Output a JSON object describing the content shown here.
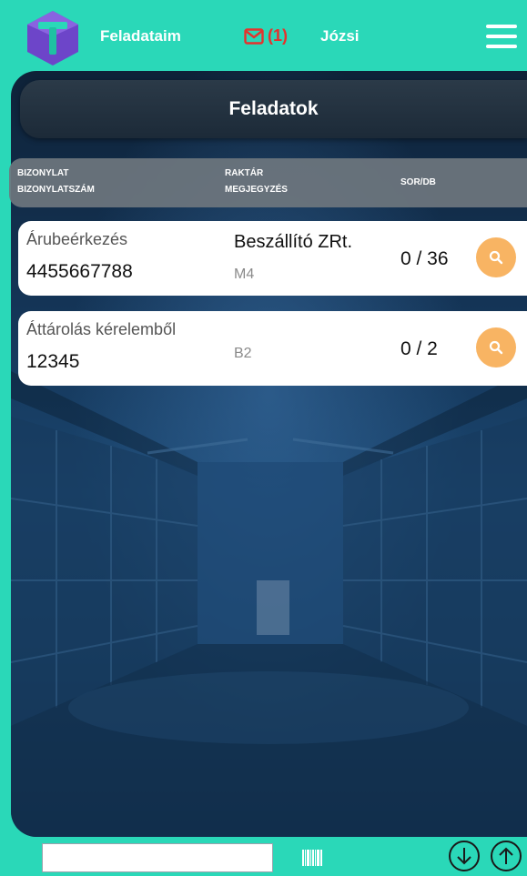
{
  "header": {
    "nav_title": "Feladataim",
    "mail_count": "(1)",
    "user_name": "Józsi",
    "icons": {
      "logo": "app-logo",
      "mail": "envelope-icon",
      "menu": "hamburger-menu-icon"
    }
  },
  "panel": {
    "title": "Feladatok"
  },
  "columns": {
    "col1_line1": "BIZONYLAT",
    "col1_line2": "BIZONYLATSZÁM",
    "col2_line1": "RAKTÁR",
    "col2_line2": "MEGJEGYZÉS",
    "col3": "SOR/DB"
  },
  "tasks": [
    {
      "type": "Árubeérkezés",
      "number": "4455667788",
      "supplier": "Beszállító ZRt.",
      "store": "M4",
      "count": "0 / 36"
    },
    {
      "type": "Áttárolás kérelemből",
      "number": "12345",
      "supplier": "",
      "store": "B2",
      "count": "0 / 2"
    }
  ],
  "footer": {
    "scan_value": "",
    "icons": {
      "barcode": "barcode-icon",
      "down": "arrow-down-circle-icon",
      "up": "arrow-up-circle-icon"
    }
  },
  "colors": {
    "accent": "#2ad8b8",
    "search_button": "#f8b463",
    "mail_red": "#e5322d",
    "logo_purple": "#6d45c9"
  }
}
